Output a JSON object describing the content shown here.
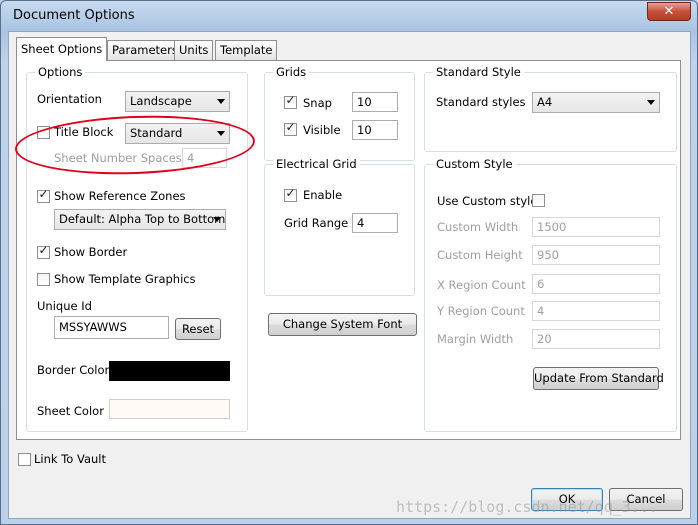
{
  "window": {
    "title": "Document Options",
    "close_glyph": "✕"
  },
  "tabs": [
    {
      "label": "Sheet Options",
      "active": true
    },
    {
      "label": "Parameters",
      "active": false
    },
    {
      "label": "Units",
      "active": false
    },
    {
      "label": "Template",
      "active": false
    }
  ],
  "options": {
    "title": "Options",
    "orientation_label": "Orientation",
    "orientation_value": "Landscape",
    "title_block_label": "Title Block",
    "title_block_checked": false,
    "title_block_value": "Standard",
    "sheet_number_spaces_label": "Sheet Number Spaces",
    "sheet_number_spaces_value": "4",
    "show_reference_zones_label": "Show Reference Zones",
    "show_reference_zones_checked": true,
    "reference_zones_value": "Default: Alpha Top to Bottom",
    "show_border_label": "Show Border",
    "show_border_checked": true,
    "show_template_graphics_label": "Show Template Graphics",
    "show_template_graphics_checked": false,
    "unique_id_label": "Unique Id",
    "unique_id_value": "MSSYAWWS",
    "reset_label": "Reset",
    "border_color_label": "Border Color",
    "border_color": "#000000",
    "sheet_color_label": "Sheet Color",
    "sheet_color": "#fffaf6"
  },
  "grids": {
    "title": "Grids",
    "snap_label": "Snap",
    "snap_checked": true,
    "snap_value": "10",
    "visible_label": "Visible",
    "visible_checked": true,
    "visible_value": "10"
  },
  "electrical_grid": {
    "title": "Electrical Grid",
    "enable_label": "Enable",
    "enable_checked": true,
    "grid_range_label": "Grid Range",
    "grid_range_value": "4"
  },
  "change_system_font_label": "Change System Font",
  "standard_style": {
    "title": "Standard Style",
    "label": "Standard styles",
    "value": "A4"
  },
  "custom_style": {
    "title": "Custom Style",
    "use_custom_label": "Use Custom style",
    "use_custom_checked": false,
    "custom_width_label": "Custom Width",
    "custom_width_value": "1500",
    "custom_height_label": "Custom Height",
    "custom_height_value": "950",
    "x_region_label": "X Region Count",
    "x_region_value": "6",
    "y_region_label": "Y Region Count",
    "y_region_value": "4",
    "margin_width_label": "Margin Width",
    "margin_width_value": "20",
    "update_button_label": "Update From Standard"
  },
  "link_to_vault_label": "Link To Vault",
  "link_to_vault_checked": false,
  "ok_label": "OK",
  "cancel_label": "Cancel",
  "watermark": "https://blog.csdn.net/qq_3...",
  "annotation_color": "#e0001a"
}
